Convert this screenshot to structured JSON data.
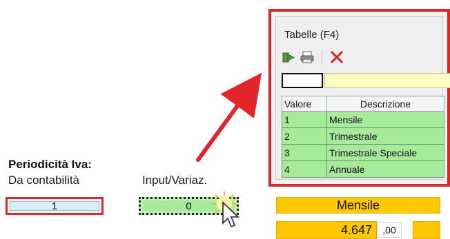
{
  "periodicity": {
    "title": "Periodicità Iva:",
    "from_accounting_label": "Da contabilità",
    "from_accounting_value": "1",
    "input_label": "Input/Variaz.",
    "input_value": "0"
  },
  "result": {
    "period_name": "Mensile",
    "amount": "4.647",
    "decimals": ",00"
  },
  "table_popup": {
    "title": "Tabelle (F4)",
    "toolbar": [
      {
        "name": "exit-icon",
        "glyph": "▶"
      },
      {
        "name": "print-icon",
        "glyph": "🖨"
      },
      {
        "name": "delete-icon",
        "glyph": "✕"
      }
    ],
    "search_value": "",
    "columns": [
      "Valore",
      "Descrizione"
    ],
    "rows": [
      {
        "value": "1",
        "description": "Mensile"
      },
      {
        "value": "2",
        "description": "Trimestrale"
      },
      {
        "value": "3",
        "description": "Trimestrale Speciale"
      },
      {
        "value": "4",
        "description": "Annuale"
      }
    ]
  },
  "colors": {
    "highlight_red": "#e3242b",
    "row_green": "#a7ea9c",
    "result_yellow": "#ffc800",
    "field_blue": "#d4f1f8",
    "search_yellow": "#fffcc4"
  }
}
